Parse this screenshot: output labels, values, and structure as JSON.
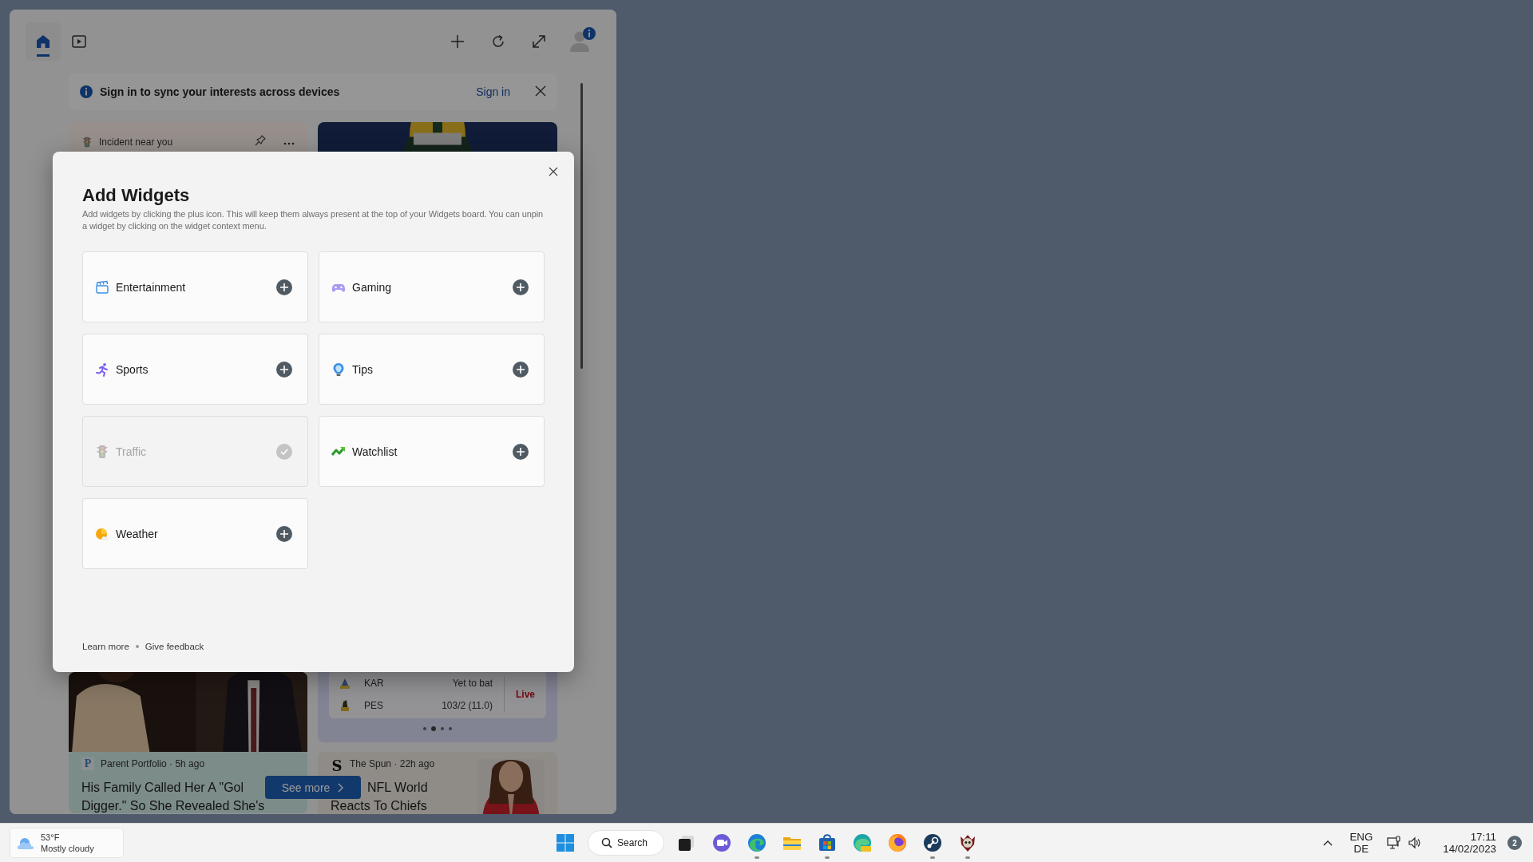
{
  "panel": {
    "tabs": [
      {
        "kind": "home",
        "selected": true
      },
      {
        "kind": "video",
        "selected": false
      }
    ],
    "signin_banner": {
      "message": "Sign in to sync your interests across devices",
      "action": "Sign in"
    },
    "traffic_card": {
      "title": "Incident near you"
    },
    "news_story": {
      "logo": "P",
      "source": "Parent Portfolio · 5h ago",
      "headline_lines": [
        "His Family Called Her A \"Gol",
        "Digger.\" So She Revealed She's"
      ]
    },
    "cricket_card": {
      "teams": [
        {
          "name": "KAR",
          "score": "Yet to bat"
        },
        {
          "name": "PES",
          "score": "103/2 (11.0)"
        }
      ],
      "status": "Live",
      "pages": [
        {
          "selected": false
        },
        {
          "selected": true
        },
        {
          "selected": false
        },
        {
          "selected": false
        }
      ]
    },
    "spun_story": {
      "logo": "S",
      "source": "The Spun · 22h ago",
      "headline_lines": [
        "NFL World",
        "Reacts To Chiefs"
      ]
    },
    "see_more": "See more"
  },
  "dialog": {
    "title": "Add Widgets",
    "description": "Add widgets by clicking the plus icon. This will keep them always present at the top of your Widgets board. You can unpin a widget by clicking on the widget context menu.",
    "widgets": [
      {
        "name": "Entertainment",
        "kind": "entertainment",
        "added": false
      },
      {
        "name": "Gaming",
        "kind": "gaming",
        "added": false
      },
      {
        "name": "Sports",
        "kind": "sports",
        "added": false
      },
      {
        "name": "Tips",
        "kind": "tips",
        "added": false
      },
      {
        "name": "Traffic",
        "kind": "traffic",
        "added": true
      },
      {
        "name": "Watchlist",
        "kind": "watchlist",
        "added": false
      },
      {
        "name": "Weather",
        "kind": "weather",
        "added": false
      }
    ],
    "footer_links": [
      "Learn more",
      "Give feedback"
    ]
  },
  "taskbar": {
    "weather": {
      "temperature": "53°F",
      "condition": "Mostly cloudy"
    },
    "search": "Search",
    "apps": [
      {
        "kind": "taskview",
        "running": false
      },
      {
        "kind": "chat",
        "running": false
      },
      {
        "kind": "edge",
        "running": true
      },
      {
        "kind": "explorer",
        "running": false
      },
      {
        "kind": "store",
        "running": true
      },
      {
        "kind": "edge-canary",
        "running": false
      },
      {
        "kind": "firefox",
        "running": false
      },
      {
        "kind": "steam",
        "running": true
      },
      {
        "kind": "app",
        "running": true
      }
    ],
    "tray": {
      "language": "ENG",
      "layout": "DE",
      "time": "17:11",
      "date": "14/02/2023",
      "notifications": "2"
    }
  }
}
